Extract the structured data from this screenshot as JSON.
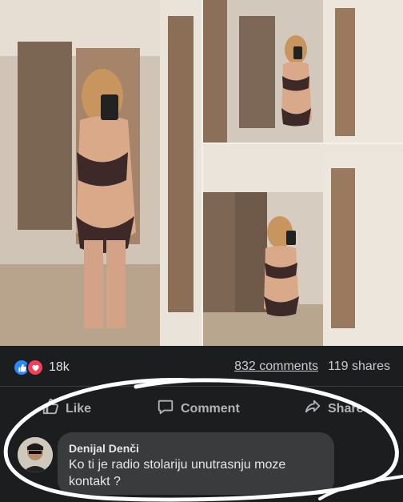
{
  "post": {
    "reaction_count": "18k",
    "comments_label": "832 comments",
    "shares_label": "119 shares"
  },
  "actions": {
    "like_label": "Like",
    "comment_label": "Comment",
    "share_label": "Share"
  },
  "comment": {
    "author": "Denijal Denči",
    "text": "Ko ti je radio stolariju unutrasnju moze kontakt ?"
  },
  "colors": {
    "background": "#18191a",
    "bubble": "#3a3b3c",
    "like_blue": "#2d88ff",
    "love_red": "#f33e58",
    "annotation": "#ffffff"
  },
  "icons": [
    "like-reaction-icon",
    "love-reaction-icon",
    "thumbs-up-icon",
    "comment-icon",
    "share-icon"
  ]
}
